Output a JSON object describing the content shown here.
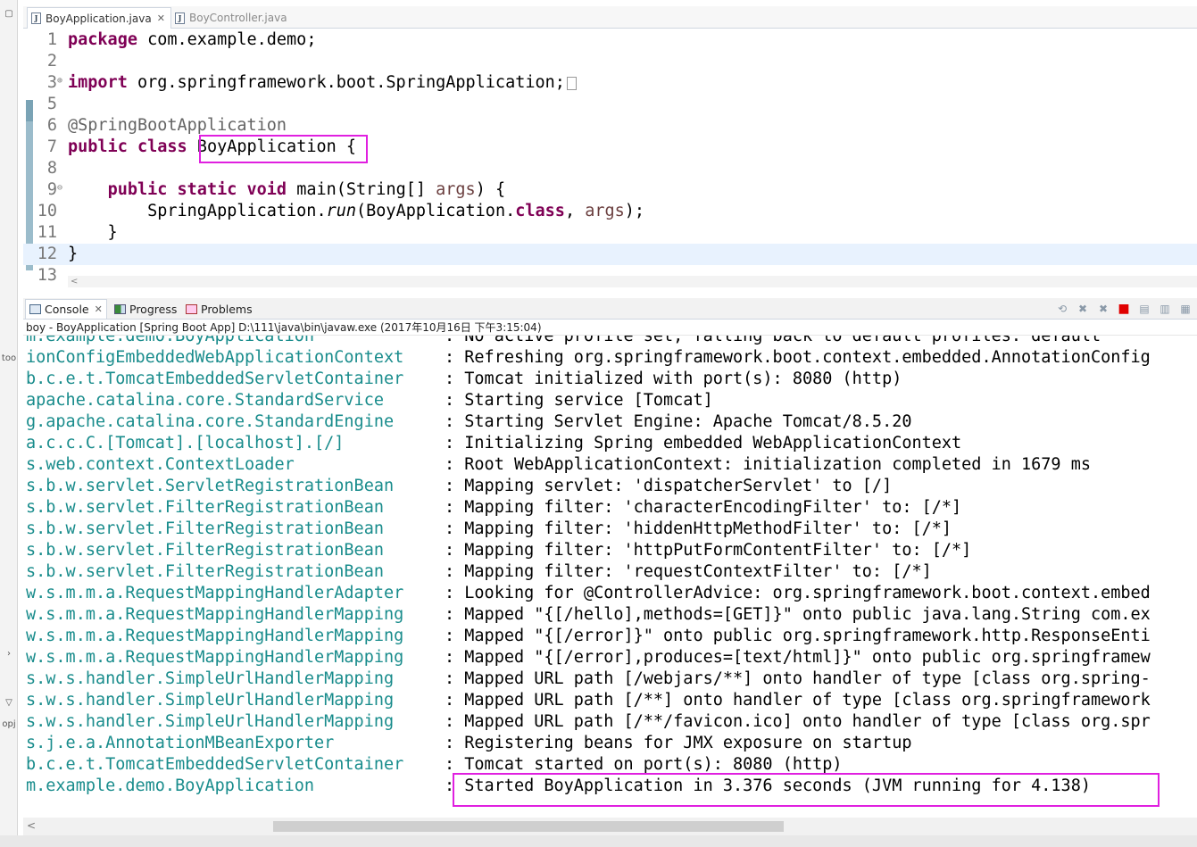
{
  "left_strip": {
    "items": [
      {
        "label": "▢"
      },
      {
        "label": "too"
      },
      {
        "label": "›"
      },
      {
        "label": "▽"
      },
      {
        "label": "opj"
      }
    ]
  },
  "editor_tabs": [
    {
      "label": "BoyApplication.java",
      "close": "✕",
      "active": true
    },
    {
      "label": "BoyController.java",
      "active": false
    }
  ],
  "editor": {
    "lines": [
      {
        "num": "1",
        "fold": "",
        "segments": [
          {
            "t": "package",
            "c": "kw"
          },
          {
            "t": " com.example.demo;",
            "c": ""
          }
        ]
      },
      {
        "num": "2",
        "fold": "",
        "segments": []
      },
      {
        "num": "3",
        "fold": "⊕",
        "segments": [
          {
            "t": "import",
            "c": "kw"
          },
          {
            "t": " org.springframework.boot.SpringApplication;",
            "c": ""
          }
        ],
        "folded_box": true
      },
      {
        "num": "5",
        "fold": "",
        "segments": []
      },
      {
        "num": "6",
        "fold": "",
        "segments": [
          {
            "t": "@SpringBootApplication",
            "c": "ann"
          }
        ]
      },
      {
        "num": "7",
        "fold": "",
        "segments": [
          {
            "t": "public",
            "c": "kw"
          },
          {
            "t": " ",
            "c": ""
          },
          {
            "t": "class",
            "c": "kw"
          },
          {
            "t": " BoyApplication {",
            "c": ""
          }
        ]
      },
      {
        "num": "8",
        "fold": "",
        "segments": []
      },
      {
        "num": "9",
        "fold": "⊖",
        "segments": [
          {
            "t": "    ",
            "c": ""
          },
          {
            "t": "public",
            "c": "kw"
          },
          {
            "t": " ",
            "c": ""
          },
          {
            "t": "static",
            "c": "kw"
          },
          {
            "t": " ",
            "c": ""
          },
          {
            "t": "void",
            "c": "kw"
          },
          {
            "t": " main(String[] ",
            "c": ""
          },
          {
            "t": "args",
            "c": "prm"
          },
          {
            "t": ") {",
            "c": ""
          }
        ]
      },
      {
        "num": "10",
        "fold": "",
        "segments": [
          {
            "t": "        SpringApplication.",
            "c": ""
          },
          {
            "t": "run",
            "c": "it"
          },
          {
            "t": "(BoyApplication.",
            "c": ""
          },
          {
            "t": "class",
            "c": "kw"
          },
          {
            "t": ", ",
            "c": ""
          },
          {
            "t": "args",
            "c": "prm"
          },
          {
            "t": ");",
            "c": ""
          }
        ]
      },
      {
        "num": "11",
        "fold": "",
        "segments": [
          {
            "t": "    }",
            "c": ""
          }
        ]
      },
      {
        "num": "12",
        "fold": "",
        "segments": [
          {
            "t": "}",
            "c": ""
          }
        ],
        "current": true
      },
      {
        "num": "13",
        "fold": "",
        "segments": []
      }
    ],
    "scroll_arrow": "<"
  },
  "console_tabs": [
    {
      "label": "Console",
      "icon": "console-icon",
      "close": "✕",
      "active": true
    },
    {
      "label": "Progress",
      "icon": "progress-icon",
      "active": false
    },
    {
      "label": "Problems",
      "icon": "problems-icon",
      "active": false
    }
  ],
  "console_toolbar": [
    {
      "icon": "refresh-icon",
      "glyph": "⟲"
    },
    {
      "icon": "remove-launch-icon",
      "glyph": "✖"
    },
    {
      "icon": "remove-all-icon",
      "glyph": "✖"
    },
    {
      "icon": "terminate-icon",
      "glyph": "■"
    },
    {
      "icon": "clear-console-icon",
      "glyph": "▤"
    },
    {
      "icon": "scroll-lock-icon",
      "glyph": "▥"
    },
    {
      "icon": "pin-console-icon",
      "glyph": "▦"
    }
  ],
  "console_description": "boy - BoyApplication [Spring Boot App] D:\\111\\java\\bin\\javaw.exe (2017年10月16日 下午3:15:04)",
  "console_lines": [
    {
      "src": "m.example.demo.BoyApplication",
      "msg": ": No active profile set, falling back to default profiles: default"
    },
    {
      "src": "ionConfigEmbeddedWebApplicationContext",
      "msg": ": Refreshing org.springframework.boot.context.embedded.AnnotationConfig"
    },
    {
      "src": "b.c.e.t.TomcatEmbeddedServletContainer",
      "msg": ": Tomcat initialized with port(s): 8080 (http)"
    },
    {
      "src": "apache.catalina.core.StandardService",
      "msg": ": Starting service [Tomcat]"
    },
    {
      "src": "g.apache.catalina.core.StandardEngine",
      "msg": ": Starting Servlet Engine: Apache Tomcat/8.5.20"
    },
    {
      "src": "a.c.c.C.[Tomcat].[localhost].[/]",
      "msg": ": Initializing Spring embedded WebApplicationContext"
    },
    {
      "src": "s.web.context.ContextLoader",
      "msg": ": Root WebApplicationContext: initialization completed in 1679 ms"
    },
    {
      "src": "s.b.w.servlet.ServletRegistrationBean",
      "msg": ": Mapping servlet: 'dispatcherServlet' to [/]"
    },
    {
      "src": "s.b.w.servlet.FilterRegistrationBean",
      "msg": ": Mapping filter: 'characterEncodingFilter' to: [/*]"
    },
    {
      "src": "s.b.w.servlet.FilterRegistrationBean",
      "msg": ": Mapping filter: 'hiddenHttpMethodFilter' to: [/*]"
    },
    {
      "src": "s.b.w.servlet.FilterRegistrationBean",
      "msg": ": Mapping filter: 'httpPutFormContentFilter' to: [/*]"
    },
    {
      "src": "s.b.w.servlet.FilterRegistrationBean",
      "msg": ": Mapping filter: 'requestContextFilter' to: [/*]"
    },
    {
      "src": "w.s.m.m.a.RequestMappingHandlerAdapter",
      "msg": ": Looking for @ControllerAdvice: org.springframework.boot.context.embed"
    },
    {
      "src": "w.s.m.m.a.RequestMappingHandlerMapping",
      "msg": ": Mapped \"{[/hello],methods=[GET]}\" onto public java.lang.String com.ex"
    },
    {
      "src": "w.s.m.m.a.RequestMappingHandlerMapping",
      "msg": ": Mapped \"{[/error]}\" onto public org.springframework.http.ResponseEnti"
    },
    {
      "src": "w.s.m.m.a.RequestMappingHandlerMapping",
      "msg": ": Mapped \"{[/error],produces=[text/html]}\" onto public org.springframew"
    },
    {
      "src": "s.w.s.handler.SimpleUrlHandlerMapping",
      "msg": ": Mapped URL path [/webjars/**] onto handler of type [class org.spring-"
    },
    {
      "src": "s.w.s.handler.SimpleUrlHandlerMapping",
      "msg": ": Mapped URL path [/**] onto handler of type [class org.springframework"
    },
    {
      "src": "s.w.s.handler.SimpleUrlHandlerMapping",
      "msg": ": Mapped URL path [/**/favicon.ico] onto handler of type [class org.spr"
    },
    {
      "src": "s.j.e.a.AnnotationMBeanExporter",
      "msg": ": Registering beans for JMX exposure on startup"
    },
    {
      "src": "b.c.e.t.TomcatEmbeddedServletContainer",
      "msg": ": Tomcat started on port(s): 8080 (http)"
    },
    {
      "src": "m.example.demo.BoyApplication",
      "msg": ": Started BoyApplication in 3.376 seconds (JVM running for 4.138)"
    }
  ],
  "console_scroll_arrow": "<",
  "colors": {
    "keyword": "#7f0055",
    "annotation": "#646464",
    "log_source": "#198c8c",
    "highlight_box": "#e020e0",
    "current_line": "#e8f2fe"
  }
}
